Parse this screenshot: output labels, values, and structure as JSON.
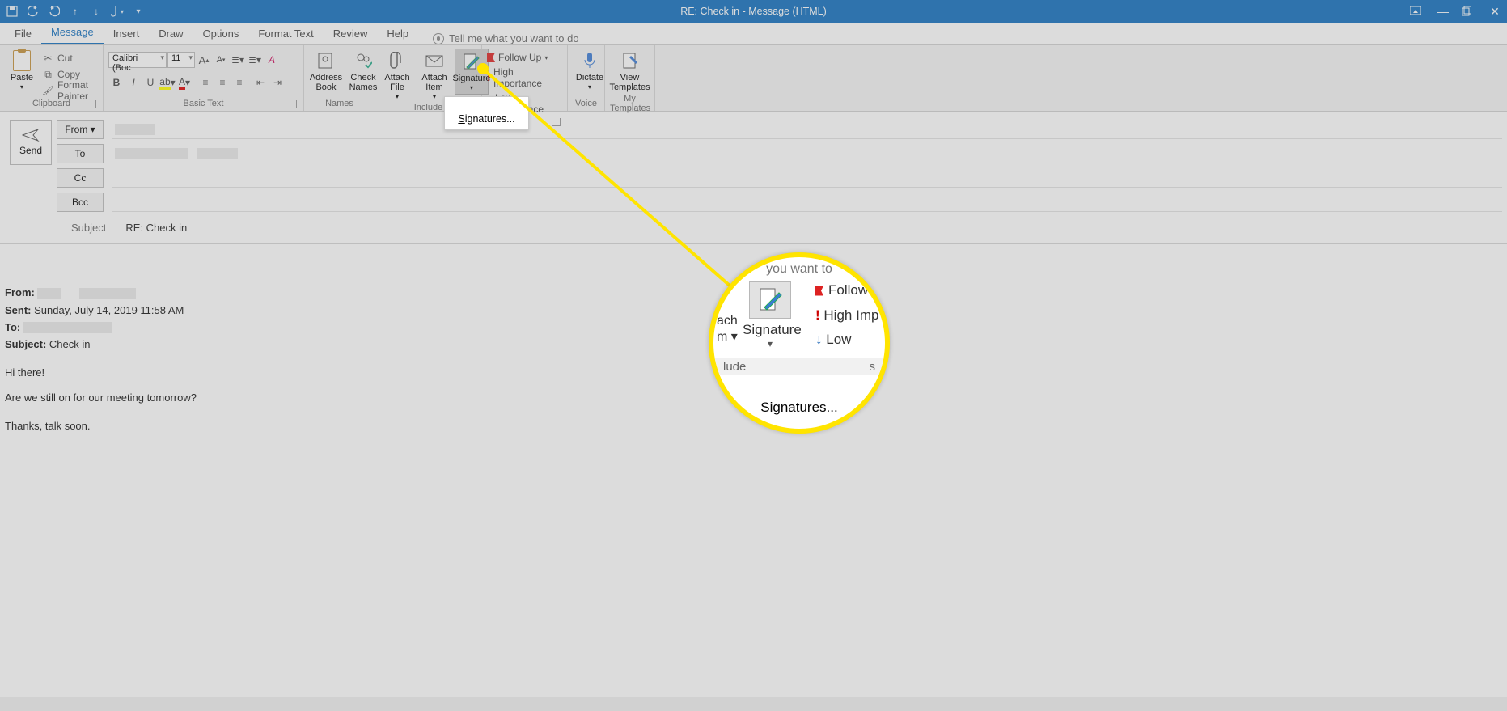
{
  "title": "RE: Check in  -  Message (HTML)",
  "tabs": {
    "file": "File",
    "message": "Message",
    "insert": "Insert",
    "draw": "Draw",
    "options": "Options",
    "formattext": "Format Text",
    "review": "Review",
    "help": "Help",
    "tellme": "Tell me what you want to do"
  },
  "ribbon": {
    "clipboard": {
      "label": "Clipboard",
      "paste": "Paste",
      "cut": "Cut",
      "copy": "Copy",
      "painter": "Format Painter"
    },
    "basictext": {
      "label": "Basic Text",
      "font": "Calibri (Boc",
      "size": "11"
    },
    "names": {
      "label": "Names",
      "address": "Address\nBook",
      "check": "Check\nNames"
    },
    "include": {
      "label": "Include",
      "attachfile": "Attach\nFile",
      "attachitem": "Attach\nItem",
      "signature": "Signature"
    },
    "tags": {
      "label": "s",
      "followup": "Follow Up",
      "high": "High Importance",
      "low": "Low Importance"
    },
    "voice": {
      "label": "Voice",
      "dictate": "Dictate"
    },
    "templates": {
      "label": "My Templates",
      "view": "View\nTemplates"
    }
  },
  "sigmenu": {
    "signatures": "Signatures..."
  },
  "compose": {
    "send": "Send",
    "from": "From",
    "to": "To",
    "cc": "Cc",
    "bcc": "Bcc",
    "subjectlabel": "Subject",
    "subjectvalue": "RE: Check in"
  },
  "body": {
    "from": "From:",
    "sent_label": "Sent:",
    "sent_value": "Sunday, July 14, 2019 11:58 AM",
    "to": "To:",
    "subject_label": "Subject:",
    "subject_value": "Check in",
    "line1": "Hi there!",
    "line2": "Are we still on for our meeting tomorrow?",
    "line3": "Thanks, talk soon."
  },
  "zoom": {
    "top": "you want to",
    "ach": "ach",
    "m": "m",
    "lude": "lude",
    "s": "s",
    "sig": "Signature",
    "follow": "Follow",
    "high": "High Imp",
    "low": "Low Impo",
    "signatures": "Signatures..."
  }
}
